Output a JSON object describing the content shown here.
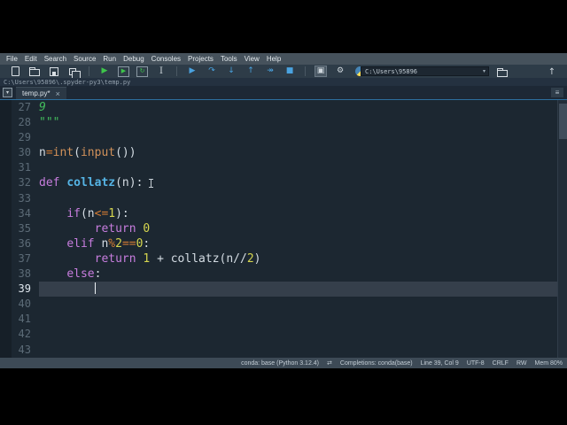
{
  "menubar": {
    "items": [
      "File",
      "Edit",
      "Search",
      "Source",
      "Run",
      "Debug",
      "Consoles",
      "Projects",
      "Tools",
      "View",
      "Help"
    ]
  },
  "toolbar": {
    "icons": [
      {
        "name": "new-file-icon",
        "cls": "shape-doc"
      },
      {
        "name": "open-file-icon",
        "cls": "shape-folder"
      },
      {
        "name": "save-icon",
        "cls": "shape-save"
      },
      {
        "name": "save-all-icon",
        "cls": "shape-saveall"
      },
      {
        "name": "separator"
      },
      {
        "name": "run-icon",
        "glyph": "▶",
        "cls": "green"
      },
      {
        "name": "run-cell-icon",
        "glyph": "▶",
        "cls": "green boxed"
      },
      {
        "name": "run-cell-advance-icon",
        "glyph": "↻",
        "cls": "green boxed"
      },
      {
        "name": "run-selection-icon",
        "glyph": "I",
        "cls": "grayI"
      },
      {
        "name": "separator"
      },
      {
        "name": "debug-icon",
        "glyph": "▶",
        "cls": "blue"
      },
      {
        "name": "step-over-icon",
        "glyph": "↷",
        "cls": "blue"
      },
      {
        "name": "step-into-icon",
        "glyph": "↓",
        "cls": "blue"
      },
      {
        "name": "step-out-icon",
        "glyph": "↑",
        "cls": "blue"
      },
      {
        "name": "continue-icon",
        "glyph": "↠",
        "cls": "blue"
      },
      {
        "name": "stop-icon",
        "glyph": "■",
        "cls": "blue"
      },
      {
        "name": "separator"
      },
      {
        "name": "maximize-pane-icon",
        "glyph": "▣",
        "cls": "gray active"
      },
      {
        "name": "preferences-icon",
        "glyph": "⚙",
        "cls": "gray"
      },
      {
        "name": "python-path-icon",
        "cls": "shape-python"
      }
    ],
    "working_dir": {
      "value": "C:\\Users\\95896",
      "dropdown_arrow": "▾",
      "up_arrow": "↑"
    }
  },
  "pathbar": {
    "path": "C:\\Users\\95896\\.spyder-py3\\temp.py"
  },
  "tabbar": {
    "browse_glyph": "▾",
    "options_glyph": "≡",
    "tabs": [
      {
        "label": "temp.py*",
        "close": "×"
      }
    ]
  },
  "editor": {
    "current_line": 39,
    "cursor_col": 9,
    "lines": [
      {
        "num": 27,
        "tokens": [
          {
            "t": "9",
            "c": "str"
          }
        ]
      },
      {
        "num": 28,
        "tokens": [
          {
            "t": "\"\"\"",
            "c": "str"
          }
        ]
      },
      {
        "num": 29,
        "tokens": []
      },
      {
        "num": 30,
        "tokens": [
          {
            "t": "n",
            "c": "pl"
          },
          {
            "t": "=",
            "c": "op"
          },
          {
            "t": "int",
            "c": "bi"
          },
          {
            "t": "(",
            "c": "pl"
          },
          {
            "t": "input",
            "c": "bi"
          },
          {
            "t": "())",
            "c": "pl"
          }
        ]
      },
      {
        "num": 31,
        "tokens": []
      },
      {
        "num": 32,
        "tokens": [
          {
            "t": "def",
            "c": "kw"
          },
          {
            "t": " ",
            "c": "pl"
          },
          {
            "t": "collatz",
            "c": "fn"
          },
          {
            "t": "(n):",
            "c": "pl"
          }
        ]
      },
      {
        "num": 33,
        "tokens": []
      },
      {
        "num": 34,
        "tokens": [
          {
            "t": "    ",
            "c": "pl"
          },
          {
            "t": "if",
            "c": "kw"
          },
          {
            "t": "(n",
            "c": "pl"
          },
          {
            "t": "<=",
            "c": "op"
          },
          {
            "t": "1",
            "c": "num"
          },
          {
            "t": "):",
            "c": "pl"
          }
        ]
      },
      {
        "num": 35,
        "tokens": [
          {
            "t": "        ",
            "c": "pl"
          },
          {
            "t": "return",
            "c": "kw"
          },
          {
            "t": " ",
            "c": "pl"
          },
          {
            "t": "0",
            "c": "num"
          }
        ]
      },
      {
        "num": 36,
        "tokens": [
          {
            "t": "    ",
            "c": "pl"
          },
          {
            "t": "elif",
            "c": "kw"
          },
          {
            "t": " n",
            "c": "pl"
          },
          {
            "t": "%",
            "c": "op"
          },
          {
            "t": "2",
            "c": "num"
          },
          {
            "t": "==",
            "c": "op"
          },
          {
            "t": "0",
            "c": "num"
          },
          {
            "t": ":",
            "c": "pl"
          }
        ]
      },
      {
        "num": 37,
        "tokens": [
          {
            "t": "        ",
            "c": "pl"
          },
          {
            "t": "return",
            "c": "kw"
          },
          {
            "t": " ",
            "c": "pl"
          },
          {
            "t": "1",
            "c": "num"
          },
          {
            "t": " + collatz(n",
            "c": "pl"
          },
          {
            "t": "//",
            "c": "pl"
          },
          {
            "t": "2",
            "c": "num"
          },
          {
            "t": ")",
            "c": "pl"
          }
        ]
      },
      {
        "num": 38,
        "tokens": [
          {
            "t": "    ",
            "c": "pl"
          },
          {
            "t": "else",
            "c": "kw"
          },
          {
            "t": ":",
            "c": "pl"
          }
        ]
      },
      {
        "num": 39,
        "tokens": []
      },
      {
        "num": 40,
        "tokens": []
      },
      {
        "num": 41,
        "tokens": []
      },
      {
        "num": 42,
        "tokens": []
      },
      {
        "num": 43,
        "tokens": []
      }
    ]
  },
  "statusbar": {
    "items": [
      {
        "name": "interpreter-status",
        "label": "conda: base (Python 3.12.4)"
      },
      {
        "name": "sync-icon",
        "label": "⇄",
        "icon": true
      },
      {
        "name": "completions-status",
        "label": "Completions: conda(base)"
      },
      {
        "name": "cursor-position",
        "label": "Line 39, Col 9"
      },
      {
        "name": "encoding-status",
        "label": "UTF-8"
      },
      {
        "name": "eol-status",
        "label": "CRLF"
      },
      {
        "name": "permissions-status",
        "label": "RW"
      },
      {
        "name": "memory-status",
        "label": "Mem 80%"
      }
    ]
  },
  "colors": {
    "letterbox": "#000000",
    "app_background": "#19232d",
    "editor_background": "#1c2731",
    "current_line_highlight": "#353f4b",
    "focus_border": "#2d6f9e",
    "keyword": "#c77dde",
    "function_def": "#55b4e5",
    "builtin": "#d1915a",
    "string": "#43bd5d",
    "number": "#d6d64f",
    "operator": "#d47b32",
    "run_green": "#3ec54b",
    "debug_blue": "#4aa3e0",
    "python_yellow": "#ffde57",
    "python_blue": "#4584b6"
  }
}
